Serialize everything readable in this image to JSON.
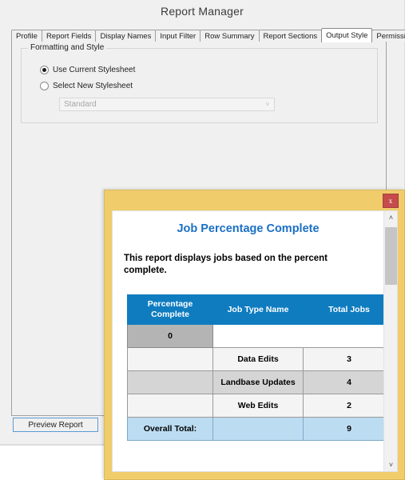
{
  "window": {
    "title": "Report Manager"
  },
  "tabs": [
    {
      "label": "Profile",
      "active": false
    },
    {
      "label": "Report Fields",
      "active": false
    },
    {
      "label": "Display Names",
      "active": false
    },
    {
      "label": "Input Filter",
      "active": false
    },
    {
      "label": "Row Summary",
      "active": false
    },
    {
      "label": "Report Sections",
      "active": false
    },
    {
      "label": "Output Style",
      "active": true
    },
    {
      "label": "Permissions",
      "active": false
    }
  ],
  "output_style": {
    "group_legend": "Formatting and Style",
    "radio_use_current": "Use Current Stylesheet",
    "radio_select_new": "Select New Stylesheet",
    "stylesheet_select_value": "Standard",
    "chevron_down": "˅"
  },
  "footer": {
    "preview_button": "Preview Report"
  },
  "popup": {
    "close_label": "x",
    "report_title": "Job Percentage Complete",
    "report_description": "This report displays jobs based on the percent complete.",
    "scroll_up": "˄",
    "scroll_down": "˅"
  },
  "chart_data": {
    "type": "table",
    "title": "Job Percentage Complete",
    "subtitle": "This report displays jobs based on the percent complete.",
    "columns": [
      "Percentage Complete",
      "Job Type Name",
      "Total Jobs"
    ],
    "group_label": "0",
    "rows": [
      {
        "percentage_complete": "",
        "job_type_name": "Data Edits",
        "total_jobs": "3"
      },
      {
        "percentage_complete": "",
        "job_type_name": "Landbase Updates",
        "total_jobs": "4"
      },
      {
        "percentage_complete": "",
        "job_type_name": "Web Edits",
        "total_jobs": "2"
      }
    ],
    "total_row": {
      "label": "Overall Total:",
      "job_type_name": "",
      "total_jobs": "9"
    },
    "colors": {
      "header_background": "#0f7cc0",
      "header_text": "#ffffff",
      "group_row": "#b4b4b4",
      "row_light": "#f4f4f4",
      "row_dark": "#d5d5d5",
      "total_row": "#bcdcf2",
      "title_text": "#1a6fc4",
      "dialog_frame": "#f0cc6b"
    }
  }
}
